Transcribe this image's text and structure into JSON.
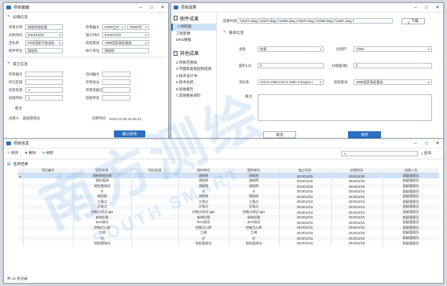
{
  "win_project": {
    "title": "项目偏偏",
    "section_required": "必填信息",
    "section_optional": "其它信息",
    "fields": {
      "project_name_label": "项目名称",
      "project_name": "测绘院地形图",
      "project_no_label": "项目编号",
      "project_no": "04000工9",
      "project_no2": "04000号",
      "start_label": "开始时间",
      "start": "2019/12/20",
      "end_label": "施工时间",
      "end": "2019/12/20",
      "coord_label": "坐标系",
      "coord": "2000国家大地坐标",
      "elev_label": "高程基准",
      "elev": "1985国家高程基准",
      "receiver_label": "接件单位",
      "receiver": "测绘院",
      "delivery_label": "执行单位",
      "delivery": "测绘院",
      "ref_label": "项目偏号",
      "contract_label": "合同编号",
      "location_label": "所在区域",
      "unit_label": "项目地址",
      "fund_label": "资金来源",
      "amount_label": "项目金额(元)",
      "accept_label": "验收时间",
      "accept_unit_label": "验收单位",
      "remarks_label": "备注",
      "creator_label": "创建人",
      "creator": "超级管理员",
      "created_label": "创建时间",
      "created": "2019-12-20 16:36:12"
    },
    "ok_button": "确认修改"
  },
  "win_result": {
    "title": "项目成果",
    "nav_header1": "图件成果",
    "nav_items1": [
      "1.地形图",
      "工程影像",
      "DRG数据"
    ],
    "nav_header2": "其他成果",
    "nav_items2": [
      "2.项目范围线",
      "3.平面和高程控制成果",
      "4.技术设计书",
      "5.技术总结",
      "6.验收报告",
      "7.其他相关资料"
    ],
    "file_list_label": "成果列表",
    "file_list": "711570.dwg;712570.dwg;713568.dwg;713570.dwg;712568.dwg;711567.dwg;7",
    "download": "下载",
    "section": "基本信息",
    "scale_label": "坐级",
    "scale": "地表",
    "ratio_label": "比例尺",
    "ratio": "1/500",
    "area_label": "面积(㎡)",
    "area": "0",
    "sheets_label": "分幅面(幅)",
    "sheets": "0",
    "coord_label": "坐标系",
    "coord": "CGCS 2000-CGCS 2000 3 Degree I",
    "elev_label": "高程基准",
    "elev": "1985国家高程基准",
    "remarks_label": "备注",
    "cancel": "取消",
    "save": "保存"
  },
  "win_list": {
    "title": "项目信息",
    "toolbar": {
      "edit": "修改",
      "delete": "删除",
      "refresh": "刷新"
    },
    "search_button": "查询",
    "list_label": "查询结果",
    "columns": [
      "项目偏号",
      "项目名称",
      "所在区域",
      "接件单位",
      "提供单位",
      "施工时间",
      "创建时间",
      "创建人员"
    ],
    "rows": [
      [
        "",
        "测绘院地形图",
        "",
        "测绘院",
        "测绘院",
        "2019/12/20",
        "2019/12/20",
        "超级管理员"
      ],
      [
        "",
        "地形图测",
        "",
        "测绘院",
        "测绘院",
        "2019/12/20",
        "2019/12/20",
        "超级管理员"
      ],
      [
        "",
        "地形图测试",
        "",
        "测绘院",
        "测绘院",
        "2019/12/20",
        "2019/12/20",
        "超级管理员"
      ],
      [
        "",
        "8",
        "",
        "8",
        "8",
        "2019/12/15",
        "2019/12/15",
        "超级管理员"
      ],
      [
        "",
        "地形图",
        "",
        "测绘院",
        "测绘院",
        "2019/12/15",
        "2019/12/15",
        "超级管理员"
      ],
      [
        "",
        "三角点",
        "",
        "三角点",
        "三角点",
        "2019/12/15",
        "2019/12/15",
        "超级管理员"
      ],
      [
        "",
        "水准点",
        "",
        "水准点",
        "水准点",
        "2019/12/15",
        "2019/12/15",
        "超级管理员"
      ],
      [
        "",
        "控制点测试-gps",
        "",
        "控制点测试-gps",
        "控制点测试-gps",
        "2019/12/15",
        "2019/12/15",
        "超级管理员"
      ],
      [
        "",
        "新地形图",
        "",
        "新地形图",
        "新地形图",
        "2019/12/15",
        "2019/12/15",
        "超级管理员"
      ],
      [
        "",
        "dem测试",
        "",
        "dem测试",
        "dem测试",
        "2019/12/15",
        "2019/12/15",
        "超级管理员"
      ],
      [
        "",
        "控制点入库",
        "",
        "控制点入库",
        "控制点入库",
        "2019/12/15",
        "2019/12/15",
        "超级管理员"
      ],
      [
        "",
        "三调",
        "",
        "三调",
        "三调",
        "2019/12/15",
        "2019/12/15",
        "超级管理员"
      ],
      [
        "",
        "tif",
        "",
        "tif",
        "tif",
        "2019/12/15",
        "2019/12/15",
        "超级管理员"
      ],
      [
        "",
        "地形图测试",
        "",
        "地形图测试",
        "地形图测试",
        "2019/12/15",
        "2019/12/15",
        "超级管理员"
      ]
    ],
    "footer": "共 14 条记录"
  },
  "watermark": {
    "big": "南方测绘",
    "small": "SOUTH SMART"
  }
}
